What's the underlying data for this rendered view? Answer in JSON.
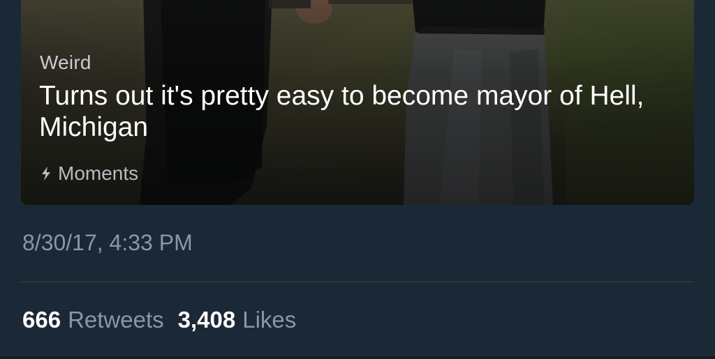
{
  "moment": {
    "category": "Weird",
    "title": "Turns out it's pretty easy to become mayor of Hell, Michigan",
    "source_label": "Moments",
    "source_icon": "lightning-bolt-icon"
  },
  "tweet": {
    "timestamp": "8/30/17, 4:33 PM",
    "retweets_count": "666",
    "retweets_label": "Retweets",
    "likes_count": "3,408",
    "likes_label": "Likes"
  },
  "colors": {
    "background": "#1b2836",
    "muted_text": "#8899a6",
    "divider": "#38444d"
  }
}
